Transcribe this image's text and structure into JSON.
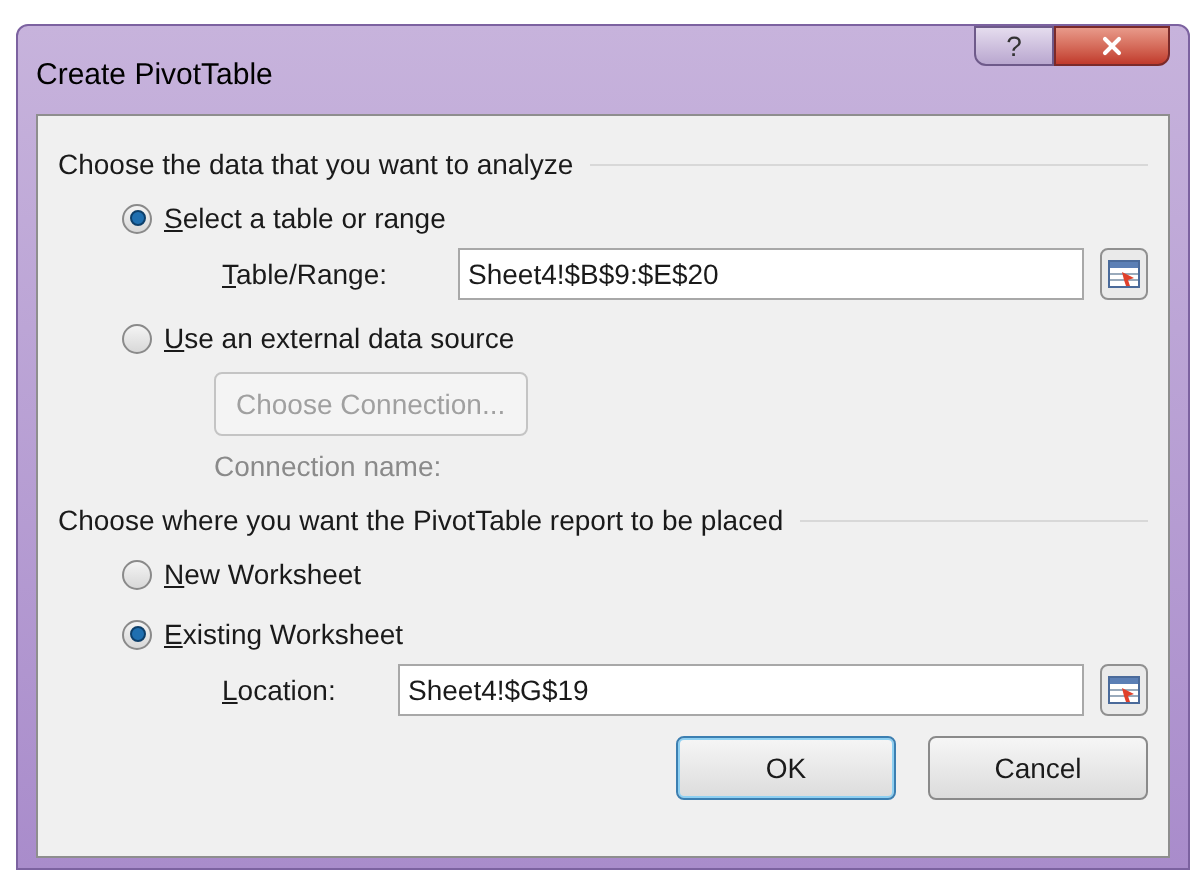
{
  "window": {
    "title": "Create PivotTable"
  },
  "title_buttons": [
    {
      "kind": "help",
      "label": "?"
    },
    {
      "kind": "close"
    }
  ],
  "sections": [
    {
      "heading": "Choose the data that you want to analyze",
      "options": [
        {
          "label": "Select a table or range",
          "selected": true,
          "field": {
            "label": "Table/Range:",
            "value": "Sheet4!$B$9:$E$20"
          }
        },
        {
          "label": "Use an external data source",
          "selected": false,
          "button": {
            "label": "Choose Connection...",
            "disabled": true
          },
          "note": "Connection name:"
        }
      ]
    },
    {
      "heading": "Choose where you want the PivotTable report to be placed",
      "options": [
        {
          "label": "New Worksheet",
          "selected": false
        },
        {
          "label": "Existing Worksheet",
          "selected": true,
          "field": {
            "label": "Location:",
            "value": "Sheet4!$G$19"
          }
        }
      ]
    }
  ],
  "buttons": [
    {
      "label": "OK",
      "default": true
    },
    {
      "label": "Cancel",
      "default": false
    }
  ]
}
